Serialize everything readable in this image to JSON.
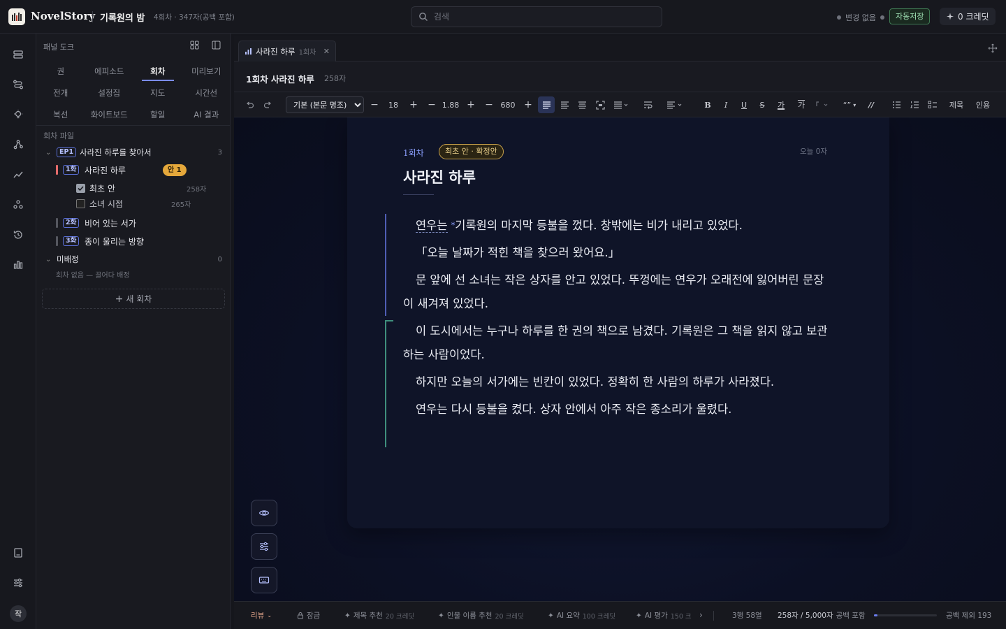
{
  "app": {
    "brand": "NovelStory",
    "project_title": "기록원의 밤",
    "project_meta": "4회차 · 347자(공백 포함)"
  },
  "search": {
    "placeholder": "검색"
  },
  "status": {
    "changes": "변경 없음",
    "autosave": "자동저장",
    "credits": "0 크레딧"
  },
  "colors": {
    "accent": "#7a8cf0",
    "draft_badge": "#e5a83b",
    "autosave": "#9fe1b4",
    "block_blue": "#4f5db5",
    "block_teal": "#3f8f7d"
  },
  "panel": {
    "dock_title": "패널 도크",
    "tabs": [
      "권",
      "에피소드",
      "회차",
      "미리보기",
      "전개",
      "설정집",
      "지도",
      "시간선",
      "복선",
      "화이트보드",
      "할일",
      "AI 결과"
    ],
    "active_tab": "회차",
    "section_label": "회차 파일",
    "episode": {
      "badge": "EP1",
      "title": "사라진 하루를 찾아서",
      "count": "3"
    },
    "chapters": [
      {
        "badge": "1화",
        "title": "사라진 하루",
        "draft_badge": "안 1",
        "bar_color": "#e46b6b"
      },
      {
        "badge": "2화",
        "title": "비어 있는 서가",
        "bar_color": "#55575f"
      },
      {
        "badge": "3화",
        "title": "종이 울리는 방향",
        "bar_color": "#55575f"
      }
    ],
    "drafts": [
      {
        "label": "최초 안",
        "count": "258자",
        "checked": true
      },
      {
        "label": "소녀 시점",
        "count": "265자",
        "checked": false
      }
    ],
    "unassigned": {
      "label": "미배정",
      "count": "0",
      "hint": "회차 없음 — 끌어다 배정"
    },
    "new_chapter": "새 회차"
  },
  "editor": {
    "tab_title": "사라진 하루",
    "tab_sub": "1회차",
    "header_title": "1회차 사라진 하루",
    "header_count": "258자",
    "toolbar": {
      "font": "기본 (본문 명조)",
      "font_size": "18",
      "line_height": "1.88",
      "width": "680",
      "bold": "B",
      "italic": "I",
      "underline": "U",
      "strike": "S",
      "ruby1": "가",
      "ruby2": "가",
      "quote_mark": "“”",
      "title_btn": "제목",
      "cite_btn": "인용"
    },
    "page": {
      "episode_no": "1회차",
      "badge": "최초 안 · 확정안",
      "today": "오늘 0자",
      "title": "사라진 하루",
      "para1_hl": "연우는",
      "para1_rest": "기록원의 마지막 등불을 껐다. 창밖에는 비가 내리고 있었다.",
      "para2": "「오늘 날짜가 적힌 책을 찾으러 왔어요.」",
      "para3": "문 앞에 선 소녀는 작은 상자를 안고 있었다. 뚜껑에는 연우가 오래전에 잃어버린 문장이 새겨져 있었다.",
      "para4": "이 도시에서는 누구나 하루를 한 권의 책으로 남겼다. 기록원은 그 책을 읽지 않고 보관하는 사람이었다.",
      "para5": "하지만 오늘의 서가에는 빈칸이 있었다. 정확히 한 사람의 하루가 사라졌다.",
      "para6": "연우는 다시 등불을 켰다. 상자 안에서 아주 작은 종소리가 울렸다."
    }
  },
  "statusbar": {
    "review": "리뷰",
    "lock": "잠금",
    "ai_title": "제목 추천",
    "ai_title_cost": "20 크레딧",
    "ai_names": "인물 이름 추천",
    "ai_names_cost": "20 크레딧",
    "ai_summary": "AI 요약",
    "ai_summary_cost": "100 크레딧",
    "ai_eval": "AI 평가",
    "ai_eval_cost": "150 크",
    "cursor": "3행 58열",
    "chars": "258자 / 5,000자",
    "chars_mode": "공백 포함",
    "progress": 0.052,
    "no_space": "공백 제외 193"
  },
  "user": {
    "avatar": "작"
  }
}
